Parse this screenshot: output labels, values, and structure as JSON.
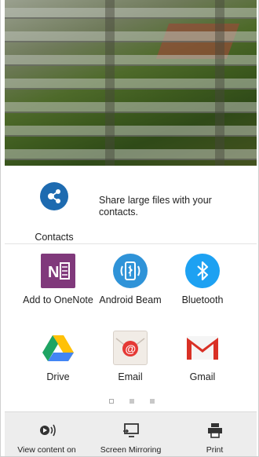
{
  "contacts": {
    "label": "Contacts",
    "description": "Share large files with your contacts.",
    "icon": "share-contacts-icon",
    "color": "#1e6bb0"
  },
  "apps": [
    {
      "label": "Add to OneNote",
      "icon": "onenote-icon"
    },
    {
      "label": "Android Beam",
      "icon": "android-beam-icon"
    },
    {
      "label": "Bluetooth",
      "icon": "bluetooth-icon"
    },
    {
      "label": "Drive",
      "icon": "drive-icon"
    },
    {
      "label": "Email",
      "icon": "email-icon"
    },
    {
      "label": "Gmail",
      "icon": "gmail-icon"
    }
  ],
  "pager": {
    "pages": 3,
    "current": 1
  },
  "bottom_bar": [
    {
      "label": "View content on",
      "icon": "cast-icon"
    },
    {
      "label": "Screen Mirroring",
      "icon": "screen-mirroring-icon"
    },
    {
      "label": "Print",
      "icon": "print-icon"
    }
  ]
}
